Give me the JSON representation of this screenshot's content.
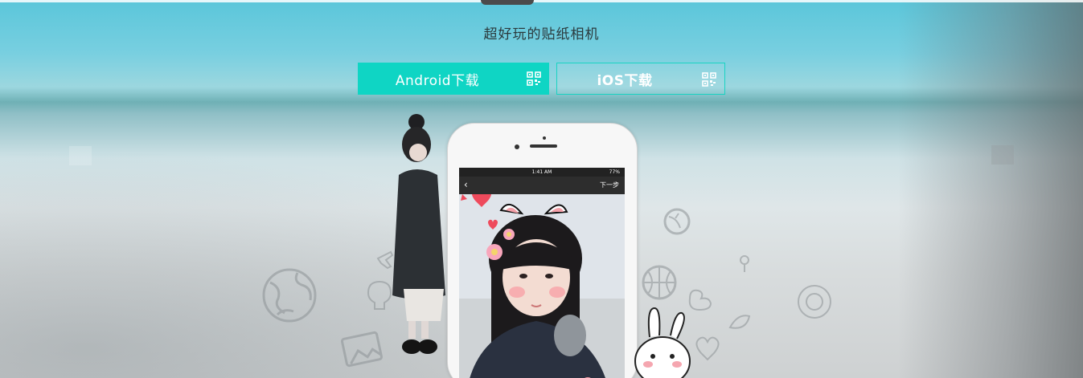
{
  "hero": {
    "slogan": "超好玩的贴纸相机"
  },
  "downloads": {
    "android_label": "Android下载",
    "ios_label": "iOS下载",
    "qr_icon": "qr-code-icon",
    "accent": "#0fd5c4"
  },
  "phone_screen": {
    "status_time": "1:41 AM",
    "battery": "77%",
    "back_icon": "chevron-left-icon",
    "next_label": "下一步"
  }
}
